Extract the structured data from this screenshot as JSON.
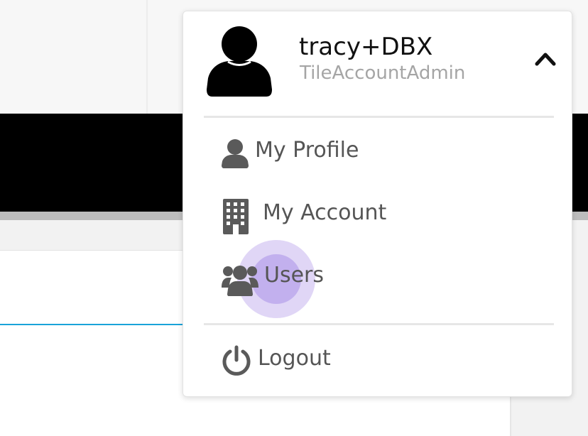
{
  "user": {
    "name": "tracy+DBX",
    "role": "TileAccountAdmin",
    "avatar_icon": "user-silhouette-icon",
    "toggle_icon": "chevron-up-icon"
  },
  "menu": {
    "items": [
      {
        "label": "My Profile",
        "icon": "person-icon"
      },
      {
        "label": "My Account",
        "icon": "building-icon"
      },
      {
        "label": "Users",
        "icon": "users-group-icon"
      },
      {
        "label": "Logout",
        "icon": "power-icon"
      }
    ]
  },
  "colors": {
    "banner": "#000000",
    "accent_line": "#1aa3d9",
    "menu_text": "#555555",
    "menu_icon": "#5a5a5a",
    "role_text": "#a5a5a5",
    "click_highlight": "#b8a4ec"
  }
}
